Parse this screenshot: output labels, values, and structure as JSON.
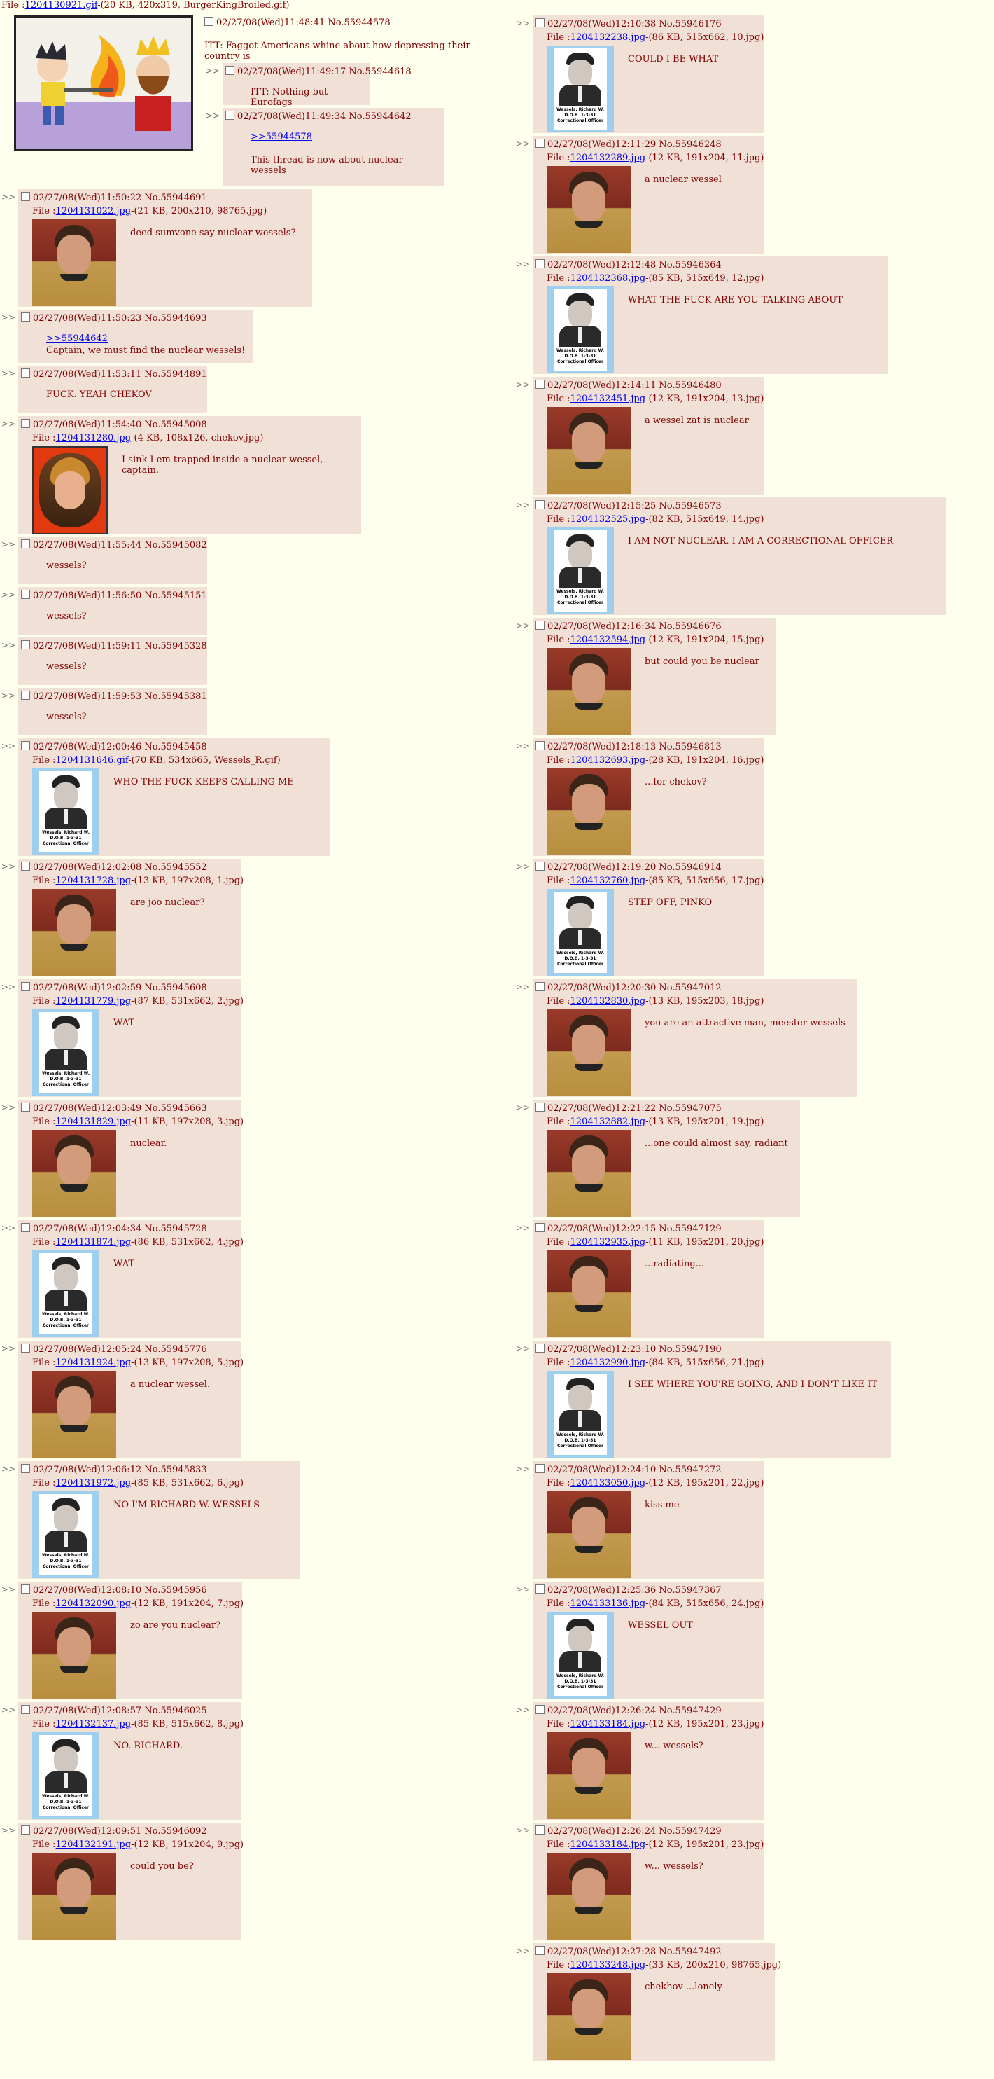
{
  "op": {
    "file_prefix": "File :",
    "file_link": "1204130921.gif",
    "file_meta": "-(20 KB, 420x319, BurgerKingBroiled.gif)",
    "date": "02/27/08(Wed)11:48:41",
    "number": "No.55944578",
    "text": "ITT: Faggot Americans whine about how depressing their country is",
    "replies": [
      {
        "date": "02/27/08(Wed)11:49:17",
        "number": "No.55944618",
        "text": "ITT: Nothing but Eurofags"
      },
      {
        "date": "02/27/08(Wed)11:49:34",
        "number": "No.55944642",
        "quote": ">>55944578",
        "text": "This thread is now about nuclear wessels"
      }
    ]
  },
  "arrows": ">>",
  "file_label": "File :",
  "left_posts": [
    {
      "date": "02/27/08(Wed)11:50:22",
      "number": "No.55944691",
      "file_link": "1204131022.jpg",
      "file_meta": "-(21 KB, 200x210, 98765.jpg)",
      "thumb": "chekov",
      "text": "deed sumvone say nuclear wessels?"
    },
    {
      "date": "02/27/08(Wed)11:50:23",
      "number": "No.55944693",
      "quote": ">>55944642",
      "text": "Captain, we must find the nuclear wessels!"
    },
    {
      "date": "02/27/08(Wed)11:53:11",
      "number": "No.55944891",
      "text": "FUCK. YEAH CHEKOV"
    },
    {
      "date": "02/27/08(Wed)11:54:40",
      "number": "No.55945008",
      "file_link": "1204131280.jpg",
      "file_meta": "-(4 KB, 108x126, chekov.jpg)",
      "thumb": "portrait",
      "text": "I sink I em trapped inside a nuclear wessel, captain."
    },
    {
      "date": "02/27/08(Wed)11:55:44",
      "number": "No.55945082",
      "text": "wessels?"
    },
    {
      "date": "02/27/08(Wed)11:56:50",
      "number": "No.55945151",
      "text": "wessels?"
    },
    {
      "date": "02/27/08(Wed)11:59:11",
      "number": "No.55945328",
      "text": "wessels?"
    },
    {
      "date": "02/27/08(Wed)11:59:53",
      "number": "No.55945381",
      "text": "wessels?"
    },
    {
      "date": "02/27/08(Wed)12:00:46",
      "number": "No.55945458",
      "file_link": "1204131646.gif",
      "file_meta": "-(70 KB, 534x665, Wessels_R.gif)",
      "thumb": "wessels",
      "text": "WHO THE FUCK KEEPS CALLING ME"
    },
    {
      "date": "02/27/08(Wed)12:02:08",
      "number": "No.55945552",
      "file_link": "1204131728.jpg",
      "file_meta": "-(13 KB, 197x208, 1.jpg)",
      "thumb": "chekov",
      "text": "are joo nuclear?"
    },
    {
      "date": "02/27/08(Wed)12:02:59",
      "number": "No.55945608",
      "file_link": "1204131779.jpg",
      "file_meta": "-(87 KB, 531x662, 2.jpg)",
      "thumb": "wessels",
      "text": "WAT"
    },
    {
      "date": "02/27/08(Wed)12:03:49",
      "number": "No.55945663",
      "file_link": "1204131829.jpg",
      "file_meta": "-(11 KB, 197x208, 3.jpg)",
      "thumb": "chekov",
      "text": "nuclear."
    },
    {
      "date": "02/27/08(Wed)12:04:34",
      "number": "No.55945728",
      "file_link": "1204131874.jpg",
      "file_meta": "-(86 KB, 531x662, 4.jpg)",
      "thumb": "wessels",
      "text": "WAT"
    },
    {
      "date": "02/27/08(Wed)12:05:24",
      "number": "No.55945776",
      "file_link": "1204131924.jpg",
      "file_meta": "-(13 KB, 197x208, 5.jpg)",
      "thumb": "chekov",
      "text": "a nuclear wessel."
    },
    {
      "date": "02/27/08(Wed)12:06:12",
      "number": "No.55945833",
      "file_link": "1204131972.jpg",
      "file_meta": "-(85 KB, 531x662, 6.jpg)",
      "thumb": "wessels",
      "text": "NO I'M RICHARD W. WESSELS"
    },
    {
      "date": "02/27/08(Wed)12:08:10",
      "number": "No.55945956",
      "file_link": "1204132090.jpg",
      "file_meta": "-(12 KB, 191x204, 7.jpg)",
      "thumb": "chekov",
      "text": "zo are you nuclear?"
    },
    {
      "date": "02/27/08(Wed)12:08:57",
      "number": "No.55946025",
      "file_link": "1204132137.jpg",
      "file_meta": "-(85 KB, 515x662, 8.jpg)",
      "thumb": "wessels",
      "text": "NO. RICHARD."
    },
    {
      "date": "02/27/08(Wed)12:09:51",
      "number": "No.55946092",
      "file_link": "1204132191.jpg",
      "file_meta": "-(12 KB, 191x204, 9.jpg)",
      "thumb": "chekov",
      "text": "could you be?"
    }
  ],
  "right_posts": [
    {
      "date": "02/27/08(Wed)12:10:38",
      "number": "No.55946176",
      "file_link": "1204132238.jpg",
      "file_meta": "-(86 KB, 515x662, 10.jpg)",
      "thumb": "wessels",
      "text": "COULD I BE WHAT"
    },
    {
      "date": "02/27/08(Wed)12:11:29",
      "number": "No.55946248",
      "file_link": "1204132289.jpg",
      "file_meta": "-(12 KB, 191x204, 11.jpg)",
      "thumb": "chekov",
      "text": "a nuclear wessel"
    },
    {
      "date": "02/27/08(Wed)12:12:48",
      "number": "No.55946364",
      "file_link": "1204132368.jpg",
      "file_meta": "-(85 KB, 515x649, 12.jpg)",
      "thumb": "wessels",
      "text": "WHAT THE FUCK ARE YOU TALKING ABOUT"
    },
    {
      "date": "02/27/08(Wed)12:14:11",
      "number": "No.55946480",
      "file_link": "1204132451.jpg",
      "file_meta": "-(12 KB, 191x204, 13.jpg)",
      "thumb": "chekov",
      "text": "a wessel zat is nuclear"
    },
    {
      "date": "02/27/08(Wed)12:15:25",
      "number": "No.55946573",
      "file_link": "1204132525.jpg",
      "file_meta": "-(82 KB, 515x649, 14.jpg)",
      "thumb": "wessels",
      "text": "I AM NOT NUCLEAR, I AM A CORRECTIONAL OFFICER"
    },
    {
      "date": "02/27/08(Wed)12:16:34",
      "number": "No.55946676",
      "file_link": "1204132594.jpg",
      "file_meta": "-(12 KB, 191x204, 15.jpg)",
      "thumb": "chekov",
      "text": "but could you be nuclear"
    },
    {
      "date": "02/27/08(Wed)12:18:13",
      "number": "No.55946813",
      "file_link": "1204132693.jpg",
      "file_meta": "-(28 KB, 191x204, 16.jpg)",
      "thumb": "chekov",
      "text": "...for chekov?"
    },
    {
      "date": "02/27/08(Wed)12:19:20",
      "number": "No.55946914",
      "file_link": "1204132760.jpg",
      "file_meta": "-(85 KB, 515x656, 17.jpg)",
      "thumb": "wessels",
      "text": "STEP OFF, PINKO"
    },
    {
      "date": "02/27/08(Wed)12:20:30",
      "number": "No.55947012",
      "file_link": "1204132830.jpg",
      "file_meta": "-(13 KB, 195x203, 18.jpg)",
      "thumb": "chekov",
      "text": "you are an attractive man, meester wessels"
    },
    {
      "date": "02/27/08(Wed)12:21:22",
      "number": "No.55947075",
      "file_link": "1204132882.jpg",
      "file_meta": "-(13 KB, 195x201, 19.jpg)",
      "thumb": "chekov",
      "text": "...one could almost say, radiant"
    },
    {
      "date": "02/27/08(Wed)12:22:15",
      "number": "No.55947129",
      "file_link": "1204132935.jpg",
      "file_meta": "-(11 KB, 195x201, 20.jpg)",
      "thumb": "chekov",
      "text": "...radiating..."
    },
    {
      "date": "02/27/08(Wed)12:23:10",
      "number": "No.55947190",
      "file_link": "1204132990.jpg",
      "file_meta": "-(84 KB, 515x656, 21.jpg)",
      "thumb": "wessels",
      "text": "I SEE WHERE YOU'RE GOING, AND I DON'T LIKE IT"
    },
    {
      "date": "02/27/08(Wed)12:24:10",
      "number": "No.55947272",
      "file_link": "1204133050.jpg",
      "file_meta": "-(12 KB, 195x201, 22.jpg)",
      "thumb": "chekov",
      "text": "kiss me"
    },
    {
      "date": "02/27/08(Wed)12:25:36",
      "number": "No.55947367",
      "file_link": "1204133136.jpg",
      "file_meta": "-(84 KB, 515x656, 24.jpg)",
      "thumb": "wessels",
      "text": "WESSEL OUT"
    },
    {
      "date": "02/27/08(Wed)12:26:24",
      "number": "No.55947429",
      "file_link": "1204133184.jpg",
      "file_meta": "-(12 KB, 195x201, 23.jpg)",
      "thumb": "chekov",
      "text": "w... wessels?"
    },
    {
      "date": "02/27/08(Wed)12:26:24",
      "number": "No.55947429",
      "file_link": "1204133184.jpg",
      "file_meta": "-(12 KB, 195x201, 23.jpg)",
      "thumb": "chekov",
      "text": "w... wessels?"
    },
    {
      "date": "02/27/08(Wed)12:27:28",
      "number": "No.55947492",
      "file_link": "1204133248.jpg",
      "file_meta": "-(33 KB, 200x210, 98765.jpg)",
      "thumb": "chekov",
      "text": "chekhov ...lonely"
    }
  ],
  "wessels_caption": [
    "Wessels, Richard W.",
    "D.O.B. 1-3-31",
    "Correctional Officer"
  ],
  "colors": {
    "page_bg": "#ffffee",
    "reply_bg": "#f0e0d6",
    "text": "#800000",
    "link": "#0000ee"
  }
}
